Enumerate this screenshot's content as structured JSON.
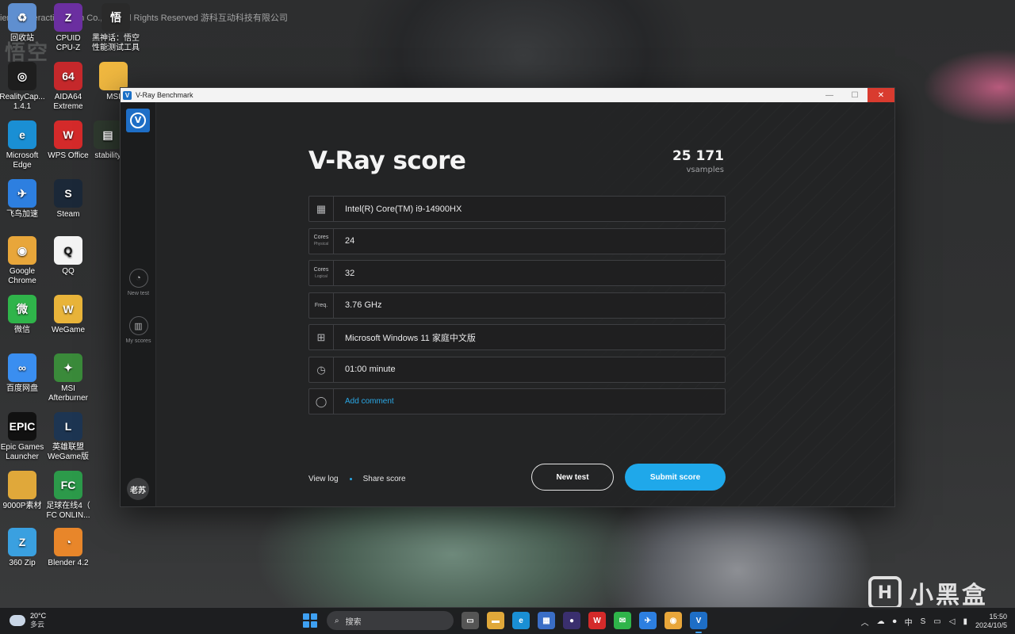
{
  "desktop": {
    "copyright": "ience Interactive Tech Co., Ltd. All Rights Reserved 游科互动科技有限公司",
    "watermark": {
      "logo": "H",
      "text": "小黑盒"
    },
    "icons": [
      {
        "label": "回收站",
        "icon": "recycle-bin-icon",
        "color": "#5f8fd0",
        "glyph": "♻"
      },
      {
        "label": "CPUID\nCPU-Z",
        "icon": "cpuz-icon",
        "color": "#6b2fa0",
        "glyph": "Z"
      },
      {
        "label": "黑神话：悟空\n性能测试工具",
        "icon": "wukong-benchmark-icon",
        "color": "#2a2a2a",
        "glyph": "悟"
      },
      {
        "label": "RealityCap...\n1.4.1",
        "icon": "realitycapture-icon",
        "color": "#1e1e1e",
        "glyph": "◎"
      },
      {
        "label": "AIDA64\nExtreme",
        "icon": "aida64-icon",
        "color": "#c5282b",
        "glyph": "64"
      },
      {
        "label": "MSI",
        "icon": "folder-icon",
        "color": "#f0b840",
        "glyph": ""
      },
      {
        "label": "Microsoft\nEdge",
        "icon": "edge-icon",
        "color": "#1a8fd4",
        "glyph": "e"
      },
      {
        "label": "WPS Office",
        "icon": "wps-icon",
        "color": "#d42a2a",
        "glyph": "W"
      },
      {
        "label": "stability",
        "icon": "stability-icon",
        "color": "#2f3a2f",
        "glyph": "▤"
      },
      {
        "label": "飞鸟加速",
        "icon": "feiniao-icon",
        "color": "#2d7fe0",
        "glyph": "✈"
      },
      {
        "label": "Steam",
        "icon": "steam-icon",
        "color": "#1b2838",
        "glyph": "S"
      },
      {
        "label": "Google\nChrome",
        "icon": "chrome-icon",
        "color": "#e8a63a",
        "glyph": "◉"
      },
      {
        "label": "QQ",
        "icon": "qq-icon",
        "color": "#f4f4f4",
        "glyph": "Q"
      },
      {
        "label": "微信",
        "icon": "wechat-icon",
        "color": "#2fb44a",
        "glyph": "微"
      },
      {
        "label": "WeGame",
        "icon": "wegame-icon",
        "color": "#e9b43a",
        "glyph": "W"
      },
      {
        "label": "百度网盘",
        "icon": "baidu-netdisk-icon",
        "color": "#3a8ef0",
        "glyph": "∞"
      },
      {
        "label": "MSI\nAfterburner",
        "icon": "afterburner-icon",
        "color": "#3a8a3a",
        "glyph": "✦"
      },
      {
        "label": "Epic Games\nLauncher",
        "icon": "epic-icon",
        "color": "#111111",
        "glyph": "EPIC"
      },
      {
        "label": "英雄联盟\nWeGame版",
        "icon": "lol-icon",
        "color": "#1d3552",
        "glyph": "L"
      },
      {
        "label": "9000P素材",
        "icon": "folder-icon",
        "color": "#e0a83a",
        "glyph": ""
      },
      {
        "label": "足球在线4（\nFC ONLIN...",
        "icon": "fc-online-icon",
        "color": "#2c9a4a",
        "glyph": "FC"
      },
      {
        "label": "360 Zip",
        "icon": "zip-icon",
        "color": "#3aa0e0",
        "glyph": "Z"
      },
      {
        "label": "Blender 4.2",
        "icon": "blender-icon",
        "color": "#e8862a",
        "glyph": "◔"
      }
    ]
  },
  "window": {
    "title": "V-Ray Benchmark",
    "controls": {
      "minimize": "—",
      "maximize": "☐",
      "close": "✕"
    }
  },
  "sidebar": {
    "new_test": "New test",
    "my_scores": "My scores",
    "user": "老苏"
  },
  "result": {
    "title": "V-Ray score",
    "score": "25 171",
    "unit": "vsamples"
  },
  "specs": [
    {
      "label": "",
      "sub": "",
      "icon": "cpu-icon",
      "glyph": "▦",
      "value": "Intel(R) Core(TM) i9-14900HX",
      "link": false
    },
    {
      "label": "Cores",
      "sub": "Physical",
      "icon": "",
      "glyph": "",
      "value": "24",
      "link": false
    },
    {
      "label": "Cores",
      "sub": "Logical",
      "icon": "",
      "glyph": "",
      "value": "32",
      "link": false
    },
    {
      "label": "Freq.",
      "sub": "",
      "icon": "",
      "glyph": "",
      "value": "3.76 GHz",
      "link": false
    },
    {
      "label": "",
      "sub": "",
      "icon": "windows-icon",
      "glyph": "⊞",
      "value": "Microsoft Windows 11 家庭中文版",
      "link": false
    },
    {
      "label": "",
      "sub": "",
      "icon": "clock-icon",
      "glyph": "◷",
      "value": "01:00 minute",
      "link": false
    },
    {
      "label": "",
      "sub": "",
      "icon": "comment-icon",
      "glyph": "◯",
      "value": "Add comment",
      "link": true
    }
  ],
  "footer": {
    "view_log": "View log",
    "share_score": "Share score",
    "new_test": "New test",
    "submit_score": "Submit score"
  },
  "taskbar": {
    "weather_temp": "20°C",
    "weather_desc": "多云",
    "search_placeholder": "搜索",
    "ime": "中",
    "time": "15:50",
    "date": "2024/10/5",
    "accent": "#1fa8ea"
  }
}
